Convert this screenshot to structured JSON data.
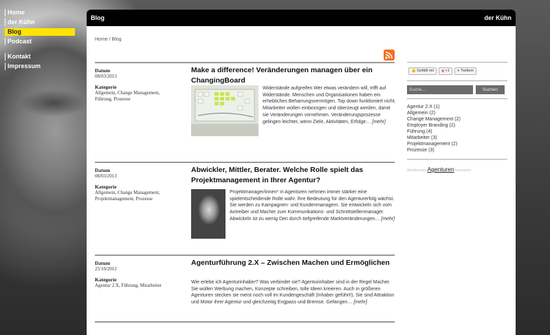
{
  "nav": {
    "items": [
      {
        "label": "Home"
      },
      {
        "label": "der Kühn"
      },
      {
        "label": "Blog"
      },
      {
        "label": "Podcast"
      },
      {
        "label": "Kontakt"
      },
      {
        "label": "Impressum"
      }
    ]
  },
  "header": {
    "left_title": "Blog",
    "right_title": "der Kühn"
  },
  "breadcrumb": {
    "home": "Home",
    "separator": " / ",
    "current": "Blog"
  },
  "labels": {
    "date": "Datum",
    "category": "Kategorie",
    "more": "[mehr]"
  },
  "articles": [
    {
      "date": "08/03/2013",
      "categories": "Allgemein, Change Management, Führung, Prozesse",
      "title": "Make a difference! Veränderungen managen über ein ChangingBoard",
      "excerpt": "Widerstände aufgreifen Wer etwas verändern will, trifft auf Widerstände. Menschen und Organisationen haben ein erhebliches Beharrungsvermögen. Top down funktioniert nicht. Mitarbeiter wollen einbezogen und überzeugt werden, damit sie Veränderungen vornehmen. Veränderungsprozesse gelingen leichter, wenn Ziele, Aktivitäten, Erfolge…"
    },
    {
      "date": "08/03/2013",
      "categories": "Allgemein, Change Management, Projektmanagement, Prozesse",
      "title": "Abwickler, Mittler, Berater. Welche Rolle spielt das Projektmanagement in Ihrer Agentur?",
      "excerpt": "Projektmanager/innen* in Agenturen nehmen immer stärker eine spielentscheidende Rolle wahr. Ihre Bedeutung für den Agenturerfolg wächst. Sie werden zu Kampagnen- und Kundenmanagern. Sie entwickeln sich vom Antreiber und Macher zum Kommunikations- und Schnittstellenmanager. Abwickeln ist zu wenig Den durch tiefgreifende Marktveränderungen…"
    },
    {
      "date": "25/10/2012",
      "categories": "Agentur 2.X, Führung, Mitarbeiter",
      "title": "Agenturführung 2.X – Zwischen Machen und Ermöglichen",
      "excerpt": "Wie erlebe ich Agenturinhaber? Was verbindet sie? Agenturinhaber sind in der Regel Macher. Sie wollen Werbung machen, Konzepte schreiben, tolle Ideen kreieren. Auch in größeren Agenturen stecken sie meist noch voll im Kundengeschäft (Inhaber geführt!). Sie sind Attraktion und Motor ihrer Agentur und gleichzeitig Engpass und Bremse. Gefangen…"
    }
  ],
  "sidebar": {
    "social": {
      "facebook": "Gefällt mir",
      "gplus": "+1",
      "twitter": "Twittern"
    },
    "search": {
      "placeholder": "Suche...",
      "button": "Suchen"
    },
    "categories": [
      {
        "label": "Agentur 2.X",
        "count": "(1)"
      },
      {
        "label": "Allgemein",
        "count": "(2)"
      },
      {
        "label": "Change Management",
        "count": "(2)"
      },
      {
        "label": "Employer Branding",
        "count": "(2)"
      },
      {
        "label": "Führung",
        "count": "(4)"
      },
      {
        "label": "Mitarbeiter",
        "count": "(3)"
      },
      {
        "label": "Projektmanagement",
        "count": "(2)"
      },
      {
        "label": "Prozesse",
        "count": "(3)"
      }
    ],
    "tags": {
      "left": "Arbeitsmarkt",
      "main": "Agenturen",
      "right": "Innovation"
    }
  },
  "colors": {
    "accent": "#ffe400",
    "rss": "#f26f21"
  }
}
